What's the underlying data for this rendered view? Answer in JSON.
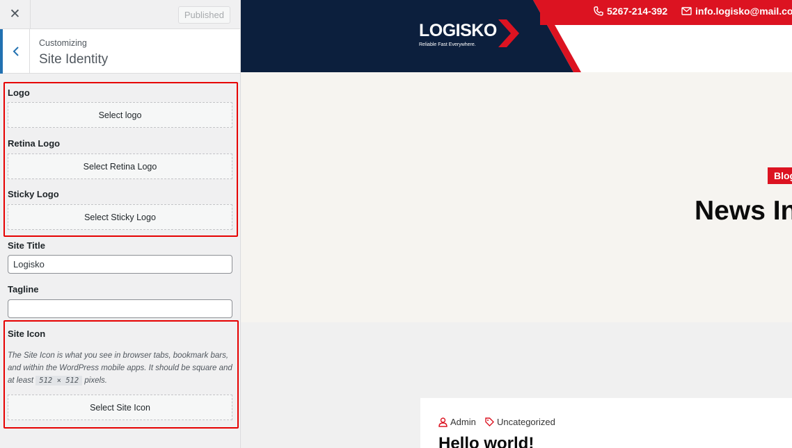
{
  "customizer": {
    "close_icon": "close-icon",
    "publish_label": "Published",
    "back_icon": "chevron-left-icon",
    "breadcrumb_small": "Customizing",
    "section_title": "Site Identity"
  },
  "controls": {
    "logo_label": "Logo",
    "logo_button": "Select logo",
    "retina_label": "Retina Logo",
    "retina_button": "Select Retina Logo",
    "sticky_label": "Sticky Logo",
    "sticky_button": "Select Sticky Logo",
    "site_title_label": "Site Title",
    "site_title_value": "Logisko",
    "tagline_label": "Tagline",
    "tagline_value": "",
    "site_icon_label": "Site Icon",
    "site_icon_desc_before": "The Site Icon is what you see in browser tabs, bookmark bars, and within the WordPress mobile apps. It should be square and at least",
    "site_icon_size": "512 × 512",
    "site_icon_desc_after": "pixels.",
    "site_icon_button": "Select Site Icon"
  },
  "preview": {
    "phone": "5267-214-392",
    "email": "info.logisko@mail.com",
    "logo_text": "LOGISKO",
    "logo_tagline": "Reliable Fast Everywhere.",
    "badge": "Blog",
    "hero_title": "News In",
    "post_author": "Admin",
    "post_category": "Uncategorized",
    "post_title": "Hello world!"
  },
  "colors": {
    "accent_blue": "#2271b1",
    "brand_red": "#dc1321",
    "brand_navy": "#0c1f3d",
    "highlight_red": "#e60000"
  }
}
